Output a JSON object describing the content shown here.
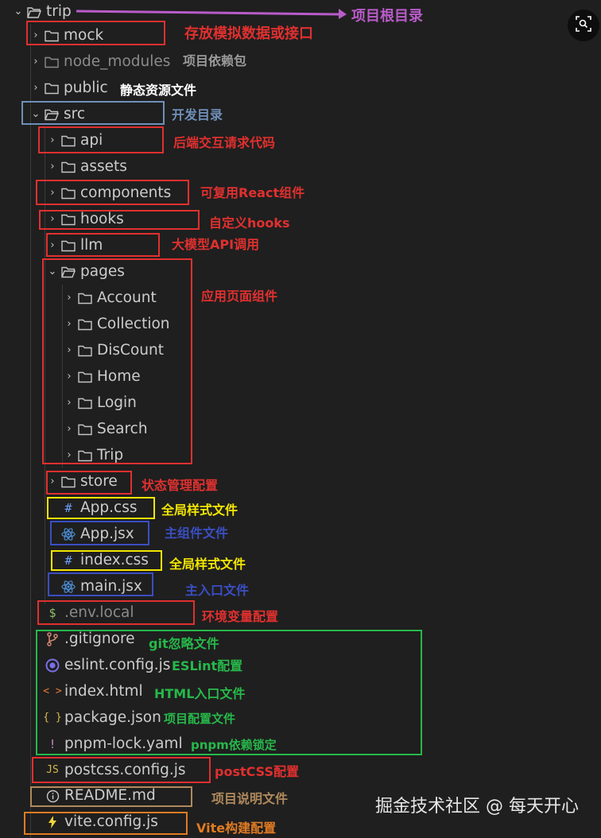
{
  "tree": {
    "root": "trip",
    "mock": "mock",
    "node_modules": "node_modules",
    "public": "public",
    "src": "src",
    "api": "api",
    "assets": "assets",
    "components": "components",
    "hooks": "hooks",
    "llm": "llm",
    "pages": "pages",
    "account": "Account",
    "collection": "Collection",
    "discount": "DisCount",
    "home": "Home",
    "login": "Login",
    "search": "Search",
    "trip": "Trip",
    "store": "store",
    "app_css": "App.css",
    "app_jsx": "App.jsx",
    "index_css": "index.css",
    "main_jsx": "main.jsx",
    "env_local": ".env.local",
    "gitignore": ".gitignore",
    "eslint": "eslint.config.js",
    "index_html": "index.html",
    "package_json": "package.json",
    "pnpm_lock": "pnpm-lock.yaml",
    "postcss": "postcss.config.js",
    "readme": "README.md",
    "vite": "vite.config.js"
  },
  "file_icons": {
    "css": "#",
    "json": "{ }",
    "js": "JS",
    "html": "< >",
    "env": "$",
    "yaml": "!"
  },
  "annotations": {
    "root": "项目根目录",
    "mock": "存放模拟数据或接口",
    "node_modules": "项目依赖包",
    "public": "静态资源文件",
    "src": "开发目录",
    "api": "后端交互请求代码",
    "components": "可复用React组件",
    "hooks": "自定义hooks",
    "llm": "大模型API调用",
    "pages": "应用页面组件",
    "store": "状态管理配置",
    "app_css": "全局样式文件",
    "app_jsx": "主组件文件",
    "index_css": "全局样式文件",
    "main_jsx": "主入口文件",
    "env_local": "环境变量配置",
    "gitignore": "git忽略文件",
    "eslint": "ESLint配置",
    "index_html": "HTML入口文件",
    "package_json": "项目配置文件",
    "pnpm_lock": "pnpm依赖锁定",
    "postcss": "postCSS配置",
    "readme": "项目说明文件",
    "vite": "Vite构建配置"
  },
  "watermark": "掘金技术社区 @ 每天开心",
  "colors": {
    "red": "#e0302f",
    "purple": "#b85cc9",
    "blue_gray": "#6f8fb8",
    "yellow": "#f2e600",
    "navy": "#3a4ec2",
    "green": "#27b84a",
    "orange": "#e07b22",
    "brown": "#b08a5c",
    "folder": "#c5c5c5",
    "react": "#4c8fd6",
    "eslint": "#7b6ee8",
    "git": "#d08770",
    "json": "#d7ba4f",
    "js": "#d7ba4f",
    "html": "#e37933",
    "env": "#8fbf6a",
    "vite": "#f0d43a"
  },
  "icons": {
    "folder": "folder-icon",
    "folder_open": "folder-open-icon",
    "react": "react-icon",
    "eslint": "eslint-icon",
    "git": "git-branch-icon",
    "info": "info-icon",
    "vite": "vite-bolt-icon",
    "lens": "visual-search-icon"
  }
}
